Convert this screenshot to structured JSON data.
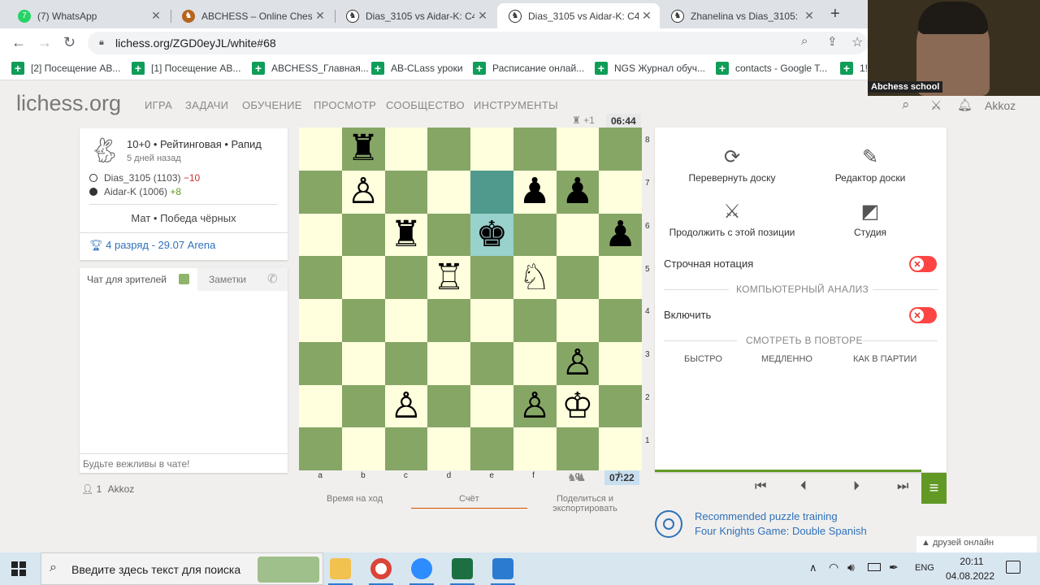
{
  "browser": {
    "tabs": [
      {
        "title": "(7) WhatsApp",
        "active": false
      },
      {
        "title": "ABCHESS – Online Chess l",
        "active": false
      },
      {
        "title": "Dias_3105 vs Aidar-K: C4",
        "active": false
      },
      {
        "title": "Dias_3105 vs Aidar-K: C4",
        "active": true
      },
      {
        "title": "Zhanelina vs Dias_3105: C",
        "active": false
      }
    ],
    "url": "lichess.org/ZGD0eyJL/white#68",
    "bookmarks": [
      "[2] Посещение АВ...",
      "[1] Посещение АВ...",
      "ABCHESS_Главная...",
      "AB-CLass уроки",
      "Расписание онлай...",
      "NGS Журнал обуч...",
      "contacts - Google T...",
      "1!"
    ]
  },
  "site": {
    "logo": "lichess.org",
    "nav": [
      "ИГРА",
      "ЗАДАЧИ",
      "ОБУЧЕНИЕ",
      "ПРОСМОТР",
      "СООБЩЕСТВО",
      "ИНСТРУМЕНТЫ"
    ],
    "username": "Akkoz"
  },
  "game": {
    "format": "10+0 • Рейтинговая • Рапид",
    "when": "5 дней назад",
    "white_player": "Dias_3105 (1103)",
    "white_delta": "−10",
    "black_player": "Aidar-K (1006)",
    "black_delta": "+8",
    "result": "Мат • Победа чёрных",
    "tournament": "4 разряд - 29.07 Arena"
  },
  "chat": {
    "tab_chat": "Чат для зрителей",
    "tab_notes": "Заметки",
    "placeholder": "Будьте вежливы в чате!",
    "spectators_count": "1",
    "spectator_name": "Akkoz"
  },
  "board": {
    "top_clock": "06:44",
    "top_material": "+1",
    "bottom_clock": "07:22",
    "files": [
      "a",
      "b",
      "c",
      "d",
      "e",
      "f",
      "g",
      "h"
    ],
    "ranks": [
      "8",
      "7",
      "6",
      "5",
      "4",
      "3",
      "2",
      "1"
    ],
    "pieces": [
      {
        "square": "b8",
        "glyph": "♜",
        "color": "black"
      },
      {
        "square": "b7",
        "glyph": "♙",
        "color": "white"
      },
      {
        "square": "f7",
        "glyph": "♟",
        "color": "black"
      },
      {
        "square": "g7",
        "glyph": "♟",
        "color": "black"
      },
      {
        "square": "c6",
        "glyph": "♜",
        "color": "black"
      },
      {
        "square": "e6",
        "glyph": "♚",
        "color": "black"
      },
      {
        "square": "h6",
        "glyph": "♟",
        "color": "black"
      },
      {
        "square": "d5",
        "glyph": "♖",
        "color": "white"
      },
      {
        "square": "f5",
        "glyph": "♘",
        "color": "white"
      },
      {
        "square": "g3",
        "glyph": "♙",
        "color": "white"
      },
      {
        "square": "c2",
        "glyph": "♙",
        "color": "white"
      },
      {
        "square": "f2",
        "glyph": "♙",
        "color": "white"
      },
      {
        "square": "g2",
        "glyph": "♔",
        "color": "white"
      }
    ],
    "last_move_from": "e7",
    "last_move_to": "e6"
  },
  "under_board_tabs": [
    "Время на ход",
    "Счёт",
    "Поделиться и экспортировать"
  ],
  "tools": {
    "flip": "Перевернуть доску",
    "editor": "Редактор доски",
    "continue": "Продолжить с этой позиции",
    "study": "Студия",
    "inline_notation": "Строчная нотация",
    "computer_analysis_header": "КОМПЬЮТЕРНЫЙ АНАЛИЗ",
    "enable": "Включить",
    "replay_header": "СМОТРЕТЬ В ПОВТОРЕ",
    "speeds": [
      "БЫСТРО",
      "МЕДЛЕННО",
      "КАК В ПАРТИИ"
    ]
  },
  "puzzle": {
    "line1": "Recommended puzzle training",
    "line2": "Four Knights Game: Double Spanish"
  },
  "friends_online": "друзей онлайн",
  "webcam_label": "Abchess school",
  "taskbar": {
    "search_placeholder": "Введите здесь текст для поиска",
    "lang": "ENG",
    "time": "20:11",
    "date": "04.08.2022"
  }
}
